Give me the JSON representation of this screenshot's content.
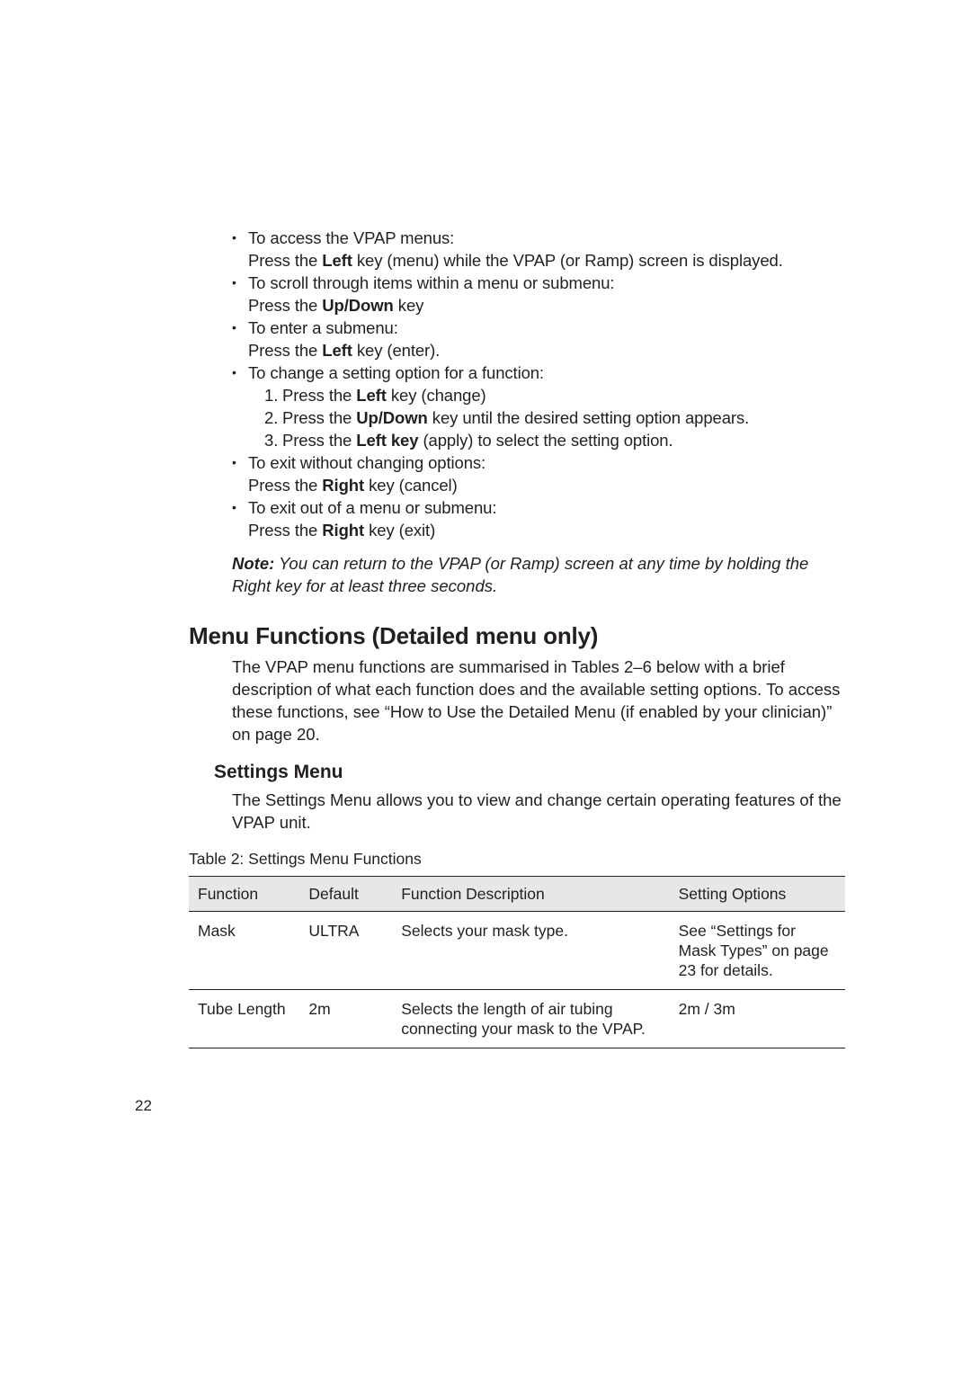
{
  "bullets": {
    "access": {
      "title": "To access the VPAP menus:",
      "line": [
        "Press the ",
        "Left",
        " key (menu) while the VPAP (or Ramp) screen is displayed."
      ]
    },
    "scroll": {
      "title": "To scroll through items within a menu or submenu:",
      "line": [
        "Press the ",
        "Up/Down",
        " key"
      ]
    },
    "enter": {
      "title": "To enter a submenu:",
      "line": [
        "Press the ",
        "Left",
        " key (enter)."
      ]
    },
    "change": {
      "title": "To change a setting option for a function:",
      "steps": [
        [
          "Press the ",
          "Left",
          " key (change)"
        ],
        [
          "Press the ",
          "Up/Down",
          " key until the desired setting option appears."
        ],
        [
          "Press the ",
          "Left key",
          " (apply) to select the setting option."
        ]
      ]
    },
    "exit_no_change": {
      "title": "To exit without changing options:",
      "line": [
        "Press the ",
        "Right",
        " key (cancel)"
      ]
    },
    "exit_menu": {
      "title": "To exit out of a menu or submenu:",
      "line": [
        "Press the ",
        "Right",
        " key (exit)"
      ]
    }
  },
  "note": {
    "label": "Note:",
    "text": " You can return to the VPAP (or Ramp) screen at any time by holding the Right key for at least three seconds."
  },
  "section_title": "Menu Functions (Detailed menu only)",
  "section_body": "The VPAP menu functions are summarised in Tables 2–6 below with a brief description of what each function does and the available setting options. To access these functions, see “How to Use the Detailed Menu (if enabled by your clinician)” on page 20.",
  "subhead": "Settings Menu",
  "subhead_body": "The Settings Menu allows you to view and change certain operating features of the VPAP unit.",
  "table": {
    "caption": "Table 2: Settings Menu Functions",
    "headers": {
      "func": "Function",
      "def": "Default",
      "desc": "Function Description",
      "opt": "Setting Options"
    },
    "rows": [
      {
        "func": "Mask",
        "def": "ULTRA",
        "desc": "Selects your mask type.",
        "opt": "See “Settings for Mask Types” on page 23 for details."
      },
      {
        "func": "Tube Length",
        "def": "2m",
        "desc": "Selects the length of air tubing connecting your mask to the VPAP.",
        "opt": "2m / 3m"
      }
    ]
  },
  "page_number": "22"
}
